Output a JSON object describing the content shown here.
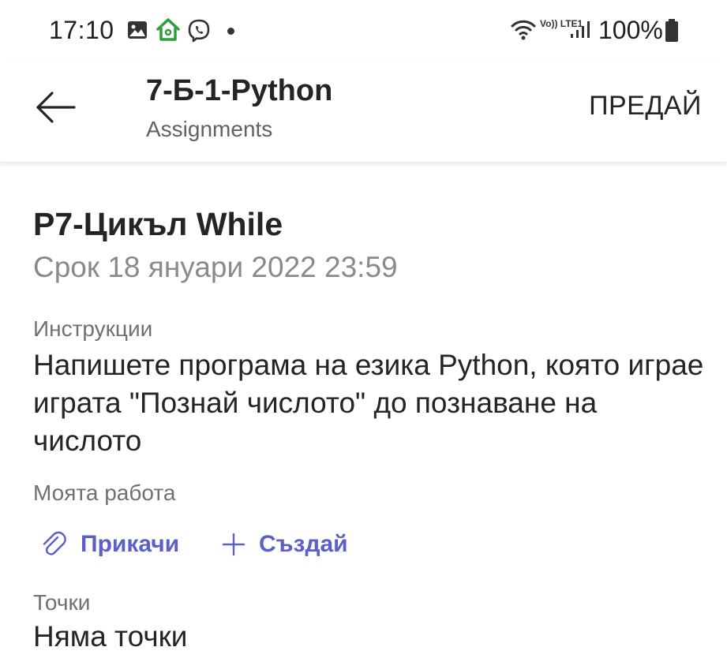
{
  "status_bar": {
    "time": "17:10",
    "battery_text": "100%",
    "network_label": "Vo)) LTE1",
    "icons": [
      "gallery-icon",
      "home-icon",
      "viber-icon",
      "notification-dot-icon",
      "wifi-icon",
      "volte-icon",
      "signal-icon",
      "battery-icon"
    ]
  },
  "header": {
    "title": "7-Б-1-Python",
    "subtitle": "Assignments",
    "back_icon": "arrow-left-icon",
    "turn_in_label": "ПРЕДАЙ"
  },
  "assignment": {
    "title": "P7-Цикъл While",
    "due": "Срок 18 януари 2022 23:59",
    "instructions_label": "Инструкции",
    "instructions_text": "Напишете програма на езика Python, която играе играта \"Познай числото\" до познаване на числото",
    "my_work_label": "Моята работа",
    "attach_label": "Прикачи",
    "attach_icon": "paperclip-icon",
    "create_label": "Създай",
    "create_icon": "plus-icon",
    "points_label": "Точки",
    "points_value": "Няма точки"
  },
  "colors": {
    "accent": "#5b5fc7",
    "text_primary": "#242424",
    "text_secondary": "#707070",
    "home_icon": "#2e9e3a"
  }
}
